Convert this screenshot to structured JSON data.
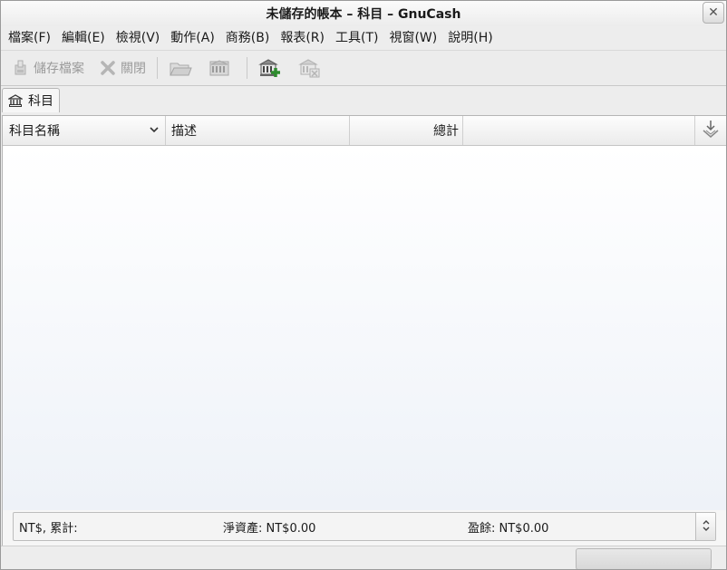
{
  "window": {
    "title": "未儲存的帳本 – 科目 – GnuCash",
    "close_icon": "close-icon"
  },
  "menubar": {
    "items": [
      {
        "label": "檔案(F)"
      },
      {
        "label": "編輯(E)"
      },
      {
        "label": "檢視(V)"
      },
      {
        "label": "動作(A)"
      },
      {
        "label": "商務(B)"
      },
      {
        "label": "報表(R)"
      },
      {
        "label": "工具(T)"
      },
      {
        "label": "視窗(W)"
      },
      {
        "label": "說明(H)"
      }
    ]
  },
  "toolbar": {
    "save_label": "儲存檔案",
    "close_label": "關閉",
    "buttons": [
      {
        "name": "save-file-button",
        "icon": "save-icon",
        "enabled": false
      },
      {
        "name": "close-book-button",
        "icon": "close-x-icon",
        "enabled": false
      },
      {
        "name": "open-button",
        "icon": "open-folder-icon",
        "enabled": false
      },
      {
        "name": "edit-account-button",
        "icon": "edit-account-icon",
        "enabled": false
      },
      {
        "name": "new-account-button",
        "icon": "new-account-icon",
        "enabled": true
      },
      {
        "name": "delete-account-button",
        "icon": "delete-account-icon",
        "enabled": false
      }
    ]
  },
  "tabs": [
    {
      "label": "科目",
      "icon": "bank-icon",
      "active": true
    }
  ],
  "tree": {
    "columns": {
      "name": "科目名稱",
      "description": "描述",
      "total": "總計"
    },
    "rows": []
  },
  "summary": {
    "label": "NT$, 累計:",
    "net_assets": "淨資產: NT$0.00",
    "profit": "盈餘: NT$0.00"
  },
  "colors": {
    "body_gradient_top": "#ffffff",
    "body_gradient_bottom": "#eef2f8",
    "disabled_text": "#9a9a9a",
    "add_green": "#2e8b2e"
  }
}
